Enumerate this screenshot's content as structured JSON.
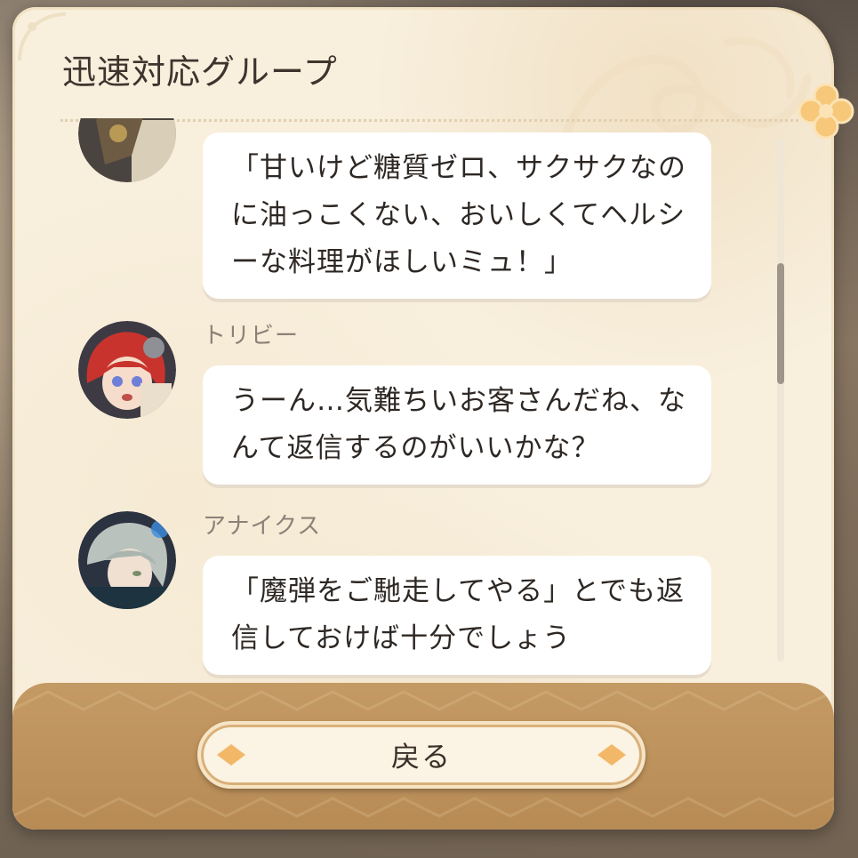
{
  "dialog": {
    "title": "迅速対応グループ",
    "back_button": "戻る"
  },
  "messages": [
    {
      "speaker": "",
      "avatar": "character-avatar-dark-armor",
      "text": "「甘いけど糖質ゼロ、サクサクなのに油っこくない、おいしくてヘルシーな料理がほしいミュ！」"
    },
    {
      "speaker": "トリビー",
      "avatar": "character-avatar-red-hair",
      "text": "うーん…気難ちいお客さんだね、なんて返信するのがいいかな？"
    },
    {
      "speaker": "アナイクス",
      "avatar": "character-avatar-silver-hair",
      "text": "「魔弾をご馳走してやる」とでも返信しておけば十分でしょう"
    }
  ],
  "colors": {
    "panel": "#f8efdd",
    "footer": "#c49a64",
    "accent": "#f2b867",
    "text": "#2e2824"
  }
}
